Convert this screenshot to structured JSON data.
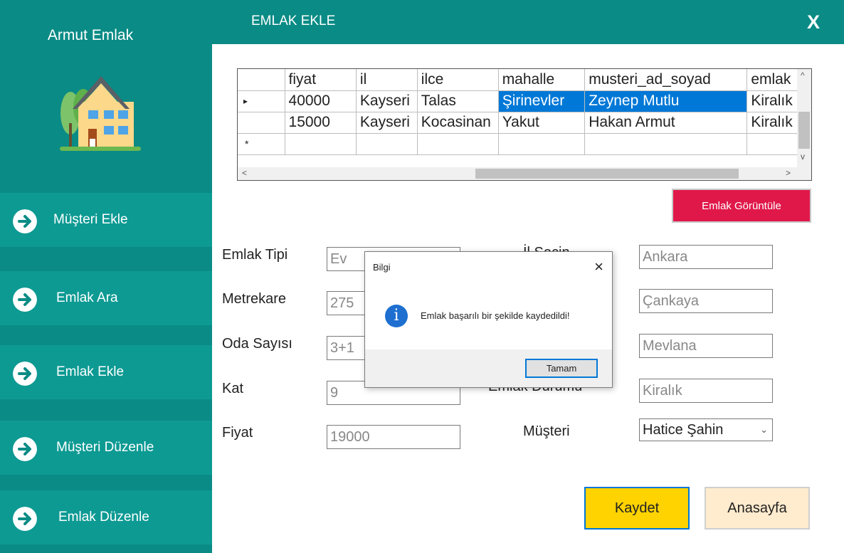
{
  "app": {
    "title": "Armut Emlak"
  },
  "header": {
    "title": "EMLAK EKLE",
    "close_label": "X"
  },
  "sidebar": {
    "items": [
      {
        "label": "Müşteri Ekle"
      },
      {
        "label": "Emlak Ara"
      },
      {
        "label": "Emlak Ekle"
      },
      {
        "label": "Müşteri Düzenle"
      },
      {
        "label": "Emlak Düzenle"
      }
    ]
  },
  "grid": {
    "columns": [
      "fiyat",
      "il",
      "ilce",
      "mahalle",
      "musteri_ad_soyad",
      "emlak"
    ],
    "rows": [
      {
        "marker": "▸",
        "fiyat": "40000",
        "il": "Kayseri",
        "ilce": "Talas",
        "mahalle": "Şirinevler",
        "musteri": "Zeynep Mutlu",
        "emlak": "Kiralık"
      },
      {
        "marker": "",
        "fiyat": "15000",
        "il": "Kayseri",
        "ilce": "Kocasinan",
        "mahalle": "Yakut",
        "musteri": "Hakan Armut",
        "emlak": "Kiralık"
      }
    ],
    "new_row_marker": "*",
    "scroll": {
      "up": "^",
      "down": "v",
      "left": "<",
      "right": ">"
    }
  },
  "buttons": {
    "view": "Emlak Görüntüle",
    "save": "Kaydet",
    "home": "Anasayfa"
  },
  "form": {
    "left": [
      {
        "label": "Emlak Tipi",
        "value": "Ev"
      },
      {
        "label": "Metrekare",
        "value": "275"
      },
      {
        "label": "Oda Sayısı",
        "value": "3+1"
      },
      {
        "label": "Kat",
        "value": "9"
      },
      {
        "label": "Fiyat",
        "value": "19000"
      }
    ],
    "right": [
      {
        "label": "İl Seçin",
        "value": "Ankara"
      },
      {
        "label": "",
        "value": "Çankaya"
      },
      {
        "label": "",
        "value": "Mevlana"
      },
      {
        "label": "Emlak Durumu",
        "value": "Kiralık"
      },
      {
        "label": "Müşteri",
        "value": "Hatice Şahin"
      }
    ]
  },
  "dialog": {
    "title": "Bilgi",
    "message": "Emlak başarılı bir şekilde kaydedildi!",
    "ok_label": "Tamam",
    "icon": "info-icon"
  },
  "colors": {
    "teal": "#0a8b85",
    "teal_light": "#0d9a93",
    "red": "#e0184a",
    "yellow": "#ffd300",
    "cream": "#ffebcd",
    "selection": "#0078d7"
  }
}
